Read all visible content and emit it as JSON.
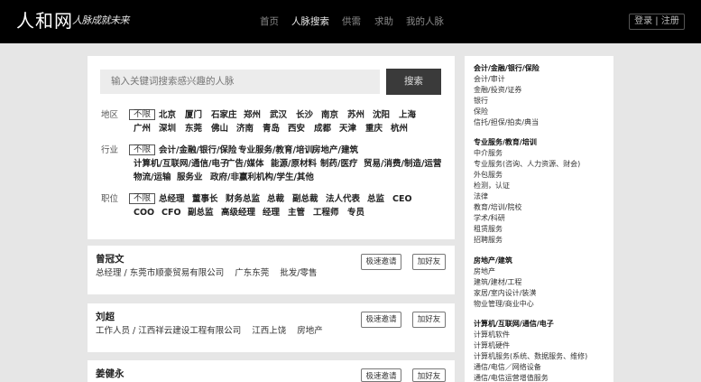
{
  "header": {
    "logo": "人和网",
    "slogan": "人脉成就未来",
    "nav": [
      {
        "label": "首页",
        "active": false
      },
      {
        "label": "人脉搜索",
        "active": true
      },
      {
        "label": "供需",
        "active": false
      },
      {
        "label": "求助",
        "active": false
      },
      {
        "label": "我的人脉",
        "active": false
      }
    ],
    "auth": "登录 | 注册"
  },
  "search": {
    "placeholder": "输入关键词搜索感兴趣的人脉",
    "button": "搜索"
  },
  "filters": {
    "region": {
      "label": "地区",
      "any": "不限",
      "options": [
        "北京",
        "厦门",
        "石家庄",
        "郑州",
        "武汉",
        "长沙",
        "南京",
        "苏州",
        "沈阳",
        "上海",
        "广州",
        "深圳",
        "东莞",
        "佛山",
        "济南",
        "青岛",
        "西安",
        "成都",
        "天津",
        "重庆",
        "杭州"
      ]
    },
    "industry": {
      "label": "行业",
      "any": "不限",
      "options": [
        "会计/金融/银行/保险",
        "专业服务/教育/培训",
        "房地产/建筑",
        "计算机/互联网/通信/电子",
        "广告/媒体",
        "能源/原材料",
        "制药/医疗",
        "贸易/消费/制造/运营",
        "物流/运输",
        "服务业",
        "政府/非赢利机构/学生/其他"
      ]
    },
    "position": {
      "label": "职位",
      "any": "不限",
      "options": [
        "总经理",
        "董事长",
        "财务总监",
        "总裁",
        "副总裁",
        "法人代表",
        "总监",
        "CEO",
        "COO",
        "CFO",
        "副总监",
        "高级经理",
        "经理",
        "主管",
        "工程师",
        "专员"
      ]
    }
  },
  "people": [
    {
      "name": "曾冠文",
      "info": [
        "总经理 / 东莞市顺豪贸易有限公司",
        "广东东莞",
        "批发/零售"
      ],
      "invite": "极速邀请",
      "add": "加好友"
    },
    {
      "name": "刘超",
      "info": [
        "工作人员 / 江西祥云建设工程有限公司",
        "江西上饶",
        "房地产"
      ],
      "invite": "极速邀请",
      "add": "加好友"
    },
    {
      "name": "姜健永",
      "info": [],
      "invite": "极速邀请",
      "add": "加好友"
    }
  ],
  "sidebar": [
    {
      "title": "会计/金融/银行/保险",
      "items": [
        "会计/审计",
        "金融/投资/证券",
        "银行",
        "保险",
        "信托/担保/拍卖/典当"
      ]
    },
    {
      "title": "专业服务/教育/培训",
      "items": [
        "中介服务",
        "专业服务(咨询、人力资源、财会)",
        "外包服务",
        "检测，认证",
        "法律",
        "教育/培训/院校",
        "学术/科研",
        "租赁服务",
        "招聘服务"
      ]
    },
    {
      "title": "房地产/建筑",
      "items": [
        "房地产",
        "建筑/建材/工程",
        "家居/室内设计/装潢",
        "物业管理/商业中心"
      ]
    },
    {
      "title": "计算机/互联网/通信/电子",
      "items": [
        "计算机软件",
        "计算机硬件",
        "计算机服务(系统、数据服务、维修)",
        "通信/电信／网络设备",
        "通信/电信运营增值服务"
      ]
    }
  ]
}
